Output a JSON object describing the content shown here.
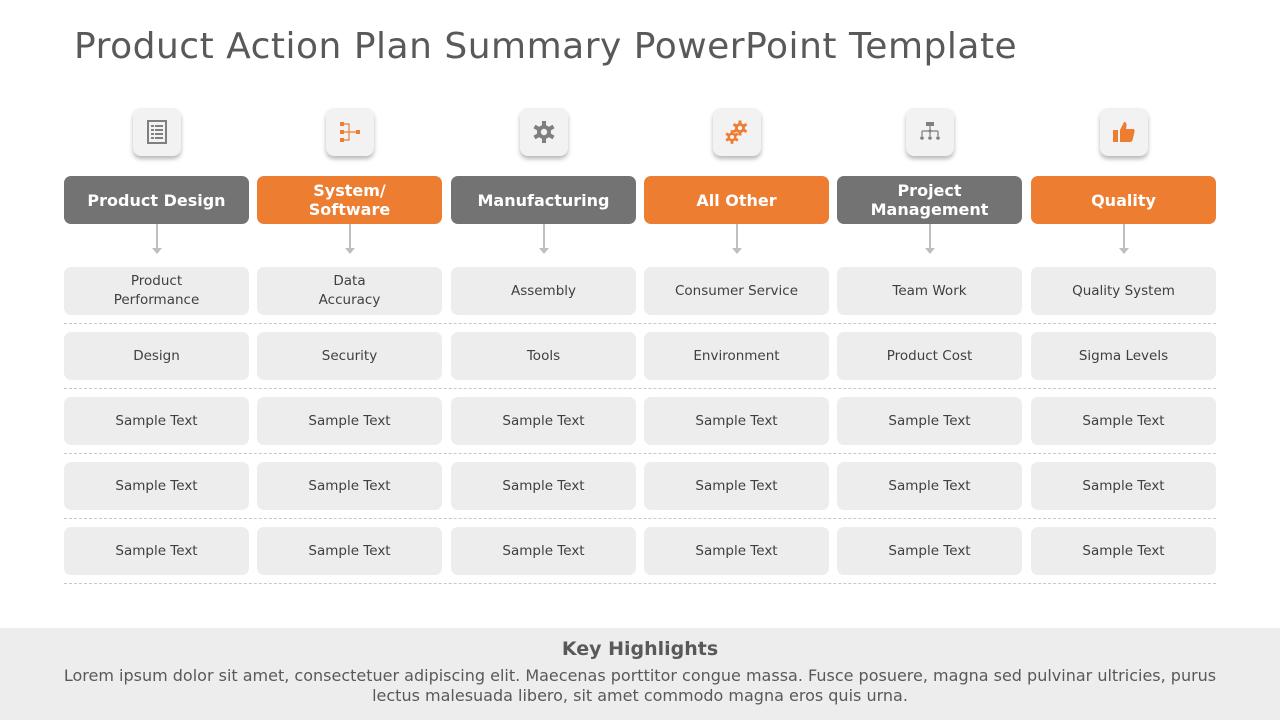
{
  "title": "Product Action Plan Summary PowerPoint Template",
  "colors": {
    "accent_orange": "#ed7d31",
    "header_gray": "#737373",
    "cell_bg": "#ededed",
    "footer_bg": "#ededed"
  },
  "columns": [
    {
      "icon": "checklist-icon",
      "header": "Product Design",
      "style": "gray",
      "cells": [
        "Product\nPerformance",
        "Design",
        "Sample Text",
        "Sample Text",
        "Sample Text"
      ]
    },
    {
      "icon": "hierarchy-flow-icon",
      "header": "System/\nSoftware",
      "style": "orange",
      "cells": [
        "Data\nAccuracy",
        "Security",
        "Sample Text",
        "Sample Text",
        "Sample Text"
      ]
    },
    {
      "icon": "gear-icon",
      "header": "Manufacturing",
      "style": "gray",
      "cells": [
        "Assembly",
        "Tools",
        "Sample Text",
        "Sample Text",
        "Sample Text"
      ]
    },
    {
      "icon": "gears-icon",
      "header": "All  Other",
      "style": "orange",
      "cells": [
        "Consumer Service",
        "Environment",
        "Sample Text",
        "Sample Text",
        "Sample Text"
      ]
    },
    {
      "icon": "org-chart-icon",
      "header": "Project\nManagement",
      "style": "gray",
      "cells": [
        "Team Work",
        "Product  Cost",
        "Sample Text",
        "Sample Text",
        "Sample Text"
      ]
    },
    {
      "icon": "thumbs-up-icon",
      "header": "Quality",
      "style": "orange",
      "cells": [
        "Quality System",
        "Sigma Levels",
        "Sample Text",
        "Sample Text",
        "Sample Text"
      ]
    }
  ],
  "footer": {
    "heading": "Key Highlights",
    "body": "Lorem ipsum dolor sit amet, consectetuer adipiscing elit. Maecenas porttitor congue massa. Fusce posuere, magna sed pulvinar ultricies, purus lectus malesuada libero, sit amet commodo magna eros quis urna."
  }
}
